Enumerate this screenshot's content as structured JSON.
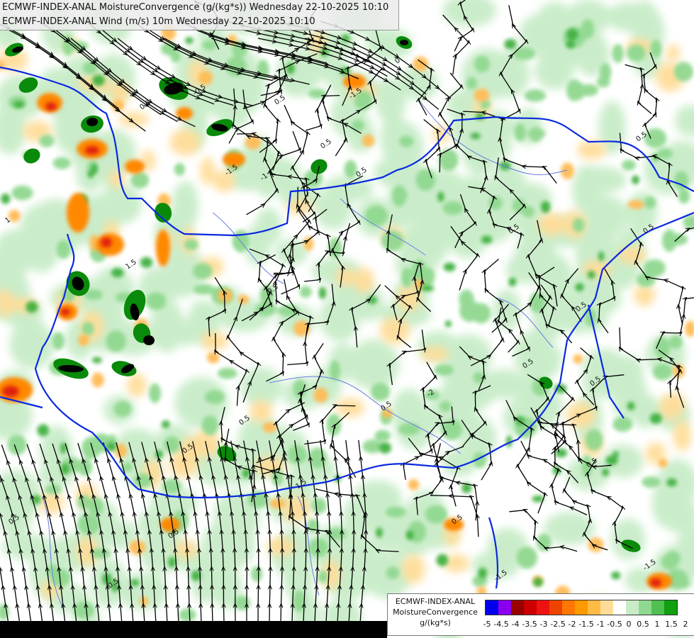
{
  "title_lines": [
    "ECMWF-INDEX-ANAL MoistureConvergence (g/(kg*s)) Wednesday 22-10-2025 10:10",
    "ECMWF-INDEX-ANAL Wind (m/s) 10m Wednesday 22-10-2025 10:10"
  ],
  "legend": {
    "title_lines": [
      "ECMWF-INDEX-ANAL",
      "MoistureConvergence",
      "g/(kg*s)"
    ],
    "tick_labels": [
      "-5",
      "-4.5",
      "-4",
      "-3.5",
      "-3",
      "-2.5",
      "-2",
      "-1.5",
      "-1",
      "-0.5",
      "0",
      "0.5",
      "1",
      "1.5",
      "2"
    ],
    "colors": [
      "#0000ee",
      "#8a00ee",
      "#990000",
      "#cc0000",
      "#ee1111",
      "#ee4400",
      "#ff7700",
      "#ff9900",
      "#ffbb44",
      "#ffdd99",
      "#ffffff",
      "#c8ecc8",
      "#90d890",
      "#50c050",
      "#10a010"
    ]
  },
  "contour_labels": [
    "0.5",
    "-1.5",
    "1.5",
    "0",
    "-0.5",
    "-1",
    "-2",
    "1"
  ],
  "colors": {
    "border": "#0a28e0",
    "river": "#6a7ce6",
    "streamline": "#000000",
    "green_light": "#c8ecc8",
    "green_mid": "#90d890",
    "green_dark": "#40b040",
    "green_vdark": "#0a8a0a",
    "black_core": "#000000",
    "orange_light": "#ffdd99",
    "orange_mid": "#ffbb55",
    "orange_dark": "#ff8800",
    "red": "#e02010"
  }
}
